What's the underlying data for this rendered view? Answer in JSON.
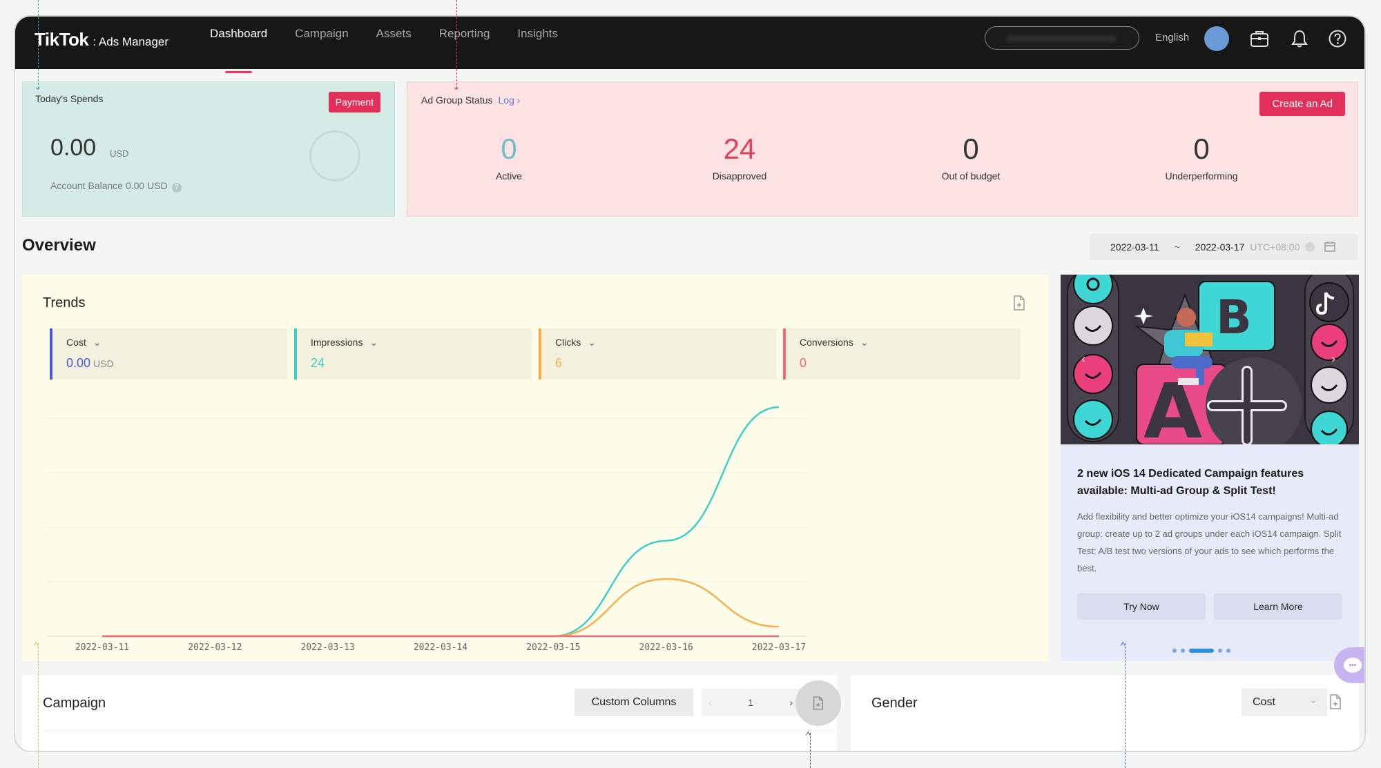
{
  "topbar": {
    "brand": "TikTok",
    "brand_sub": ": Ads Manager",
    "nav": [
      {
        "label": "Dashboard",
        "active": true
      },
      {
        "label": "Campaign",
        "active": false
      },
      {
        "label": "Assets",
        "active": false
      },
      {
        "label": "Reporting",
        "active": false
      },
      {
        "label": "Insights",
        "active": false
      }
    ],
    "language": "English",
    "icons": [
      "briefcase-icon",
      "bell-icon",
      "help-icon"
    ]
  },
  "spends": {
    "title": "Today's Spends",
    "payment_label": "Payment",
    "amount": "0.00",
    "currency": "USD",
    "balance": "Account Balance 0.00 USD"
  },
  "ad_group_status": {
    "title": "Ad Group Status",
    "log_label": "Log",
    "create_label": "Create an Ad",
    "stats": [
      {
        "value": "0",
        "label": "Active",
        "color": "#6cbfc9"
      },
      {
        "value": "24",
        "label": "Disapproved",
        "color": "#e2405e"
      },
      {
        "value": "0",
        "label": "Out of budget",
        "color": "#333333"
      },
      {
        "value": "0",
        "label": "Underperforming",
        "color": "#333333"
      }
    ]
  },
  "overview": {
    "title": "Overview",
    "date_start": "2022-03-11",
    "date_sep": "~",
    "date_end": "2022-03-17",
    "timezone": "UTC+08:00"
  },
  "trends": {
    "title": "Trends",
    "metrics": [
      {
        "label": "Cost",
        "value": "0.00",
        "unit": "USD",
        "color": "#4a59d8"
      },
      {
        "label": "Impressions",
        "value": "24",
        "unit": "",
        "color": "#3ccfca"
      },
      {
        "label": "Clicks",
        "value": "6",
        "unit": "",
        "color": "#f5b04c"
      },
      {
        "label": "Conversions",
        "value": "0",
        "unit": "",
        "color": "#ef6a78"
      }
    ]
  },
  "chart_data": {
    "type": "line",
    "x": [
      "2022-03-11",
      "2022-03-12",
      "2022-03-13",
      "2022-03-14",
      "2022-03-15",
      "2022-03-16",
      "2022-03-17"
    ],
    "series": [
      {
        "name": "Impressions",
        "color": "#3ccfca",
        "values": [
          0,
          0,
          0,
          0,
          0,
          10,
          24
        ]
      },
      {
        "name": "Clicks",
        "color": "#f5b04c",
        "values": [
          0,
          0,
          0,
          0,
          0,
          6,
          1
        ]
      },
      {
        "name": "Conversions",
        "color": "#ef6a78",
        "values": [
          0,
          0,
          0,
          0,
          0,
          0,
          0
        ]
      }
    ],
    "grid": true
  },
  "promo": {
    "title": "2 new iOS 14 Dedicated Campaign features available: Multi-ad Group & Split Test!",
    "body": "Add flexibility and better optimize your iOS14 campaigns! Multi-ad group: create up to 2 ad groups under each iOS14 campaign. Split Test: A/B test two versions of your ads to see which performs the best.",
    "try_label": "Try Now",
    "learn_label": "Learn More",
    "dots_count": 5,
    "active_dot": 2
  },
  "campaign": {
    "title": "Campaign",
    "custom_columns_label": "Custom Columns",
    "page": "1"
  },
  "gender": {
    "title": "Gender",
    "metric": "Cost"
  }
}
